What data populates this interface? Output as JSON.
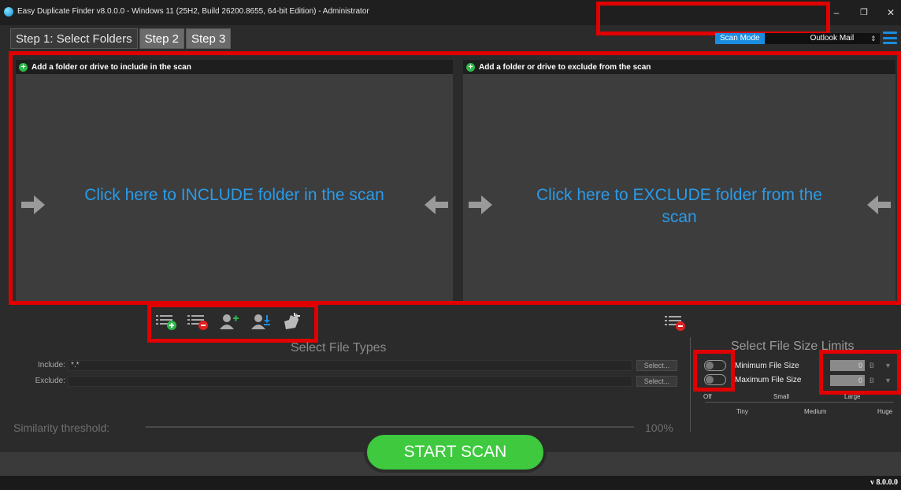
{
  "window": {
    "title": "Easy Duplicate Finder v8.0.0.0 - Windows 11 (25H2, Build 26200.8655, 64-bit Edition) - Administrator",
    "min_glyph": "–",
    "max_glyph": "❐",
    "close_glyph": "✕"
  },
  "tabs": [
    {
      "label": "Step 1: Select Folders"
    },
    {
      "label": "Step 2"
    },
    {
      "label": "Step 3"
    }
  ],
  "scan_mode": {
    "label": "Scan Mode",
    "value": "Outlook Mail",
    "arrow": "⇕"
  },
  "include_panel": {
    "header": "Add a folder or drive to include in the scan",
    "prompt": "Click here to INCLUDE folder in the scan"
  },
  "exclude_panel": {
    "header": "Add a folder or drive to exclude from the scan",
    "prompt": "Click here to EXCLUDE folder from the scan"
  },
  "file_types": {
    "title": "Select File Types",
    "include_label": "Include:",
    "include_value": "*.*",
    "exclude_label": "Exclude:",
    "exclude_value": "",
    "select_label": "Select..."
  },
  "similarity": {
    "label": "Similarity threshold:",
    "value": "100%"
  },
  "size_limits": {
    "title": "Select File Size Limits",
    "min_label": "Minimum File Size",
    "max_label": "Maximum File Size",
    "min_value": "0",
    "max_value": "0",
    "unit": "B",
    "dropdown": "▼",
    "scale_top": [
      "Off",
      "Small",
      "Large"
    ],
    "scale_bottom": [
      "Tiny",
      "Medium",
      "Huge"
    ]
  },
  "start_button": "START SCAN",
  "version": "v 8.0.0.0",
  "colors": {
    "accent": "#1b8de0",
    "highlight": "#e00000",
    "start": "#3ec93e"
  }
}
